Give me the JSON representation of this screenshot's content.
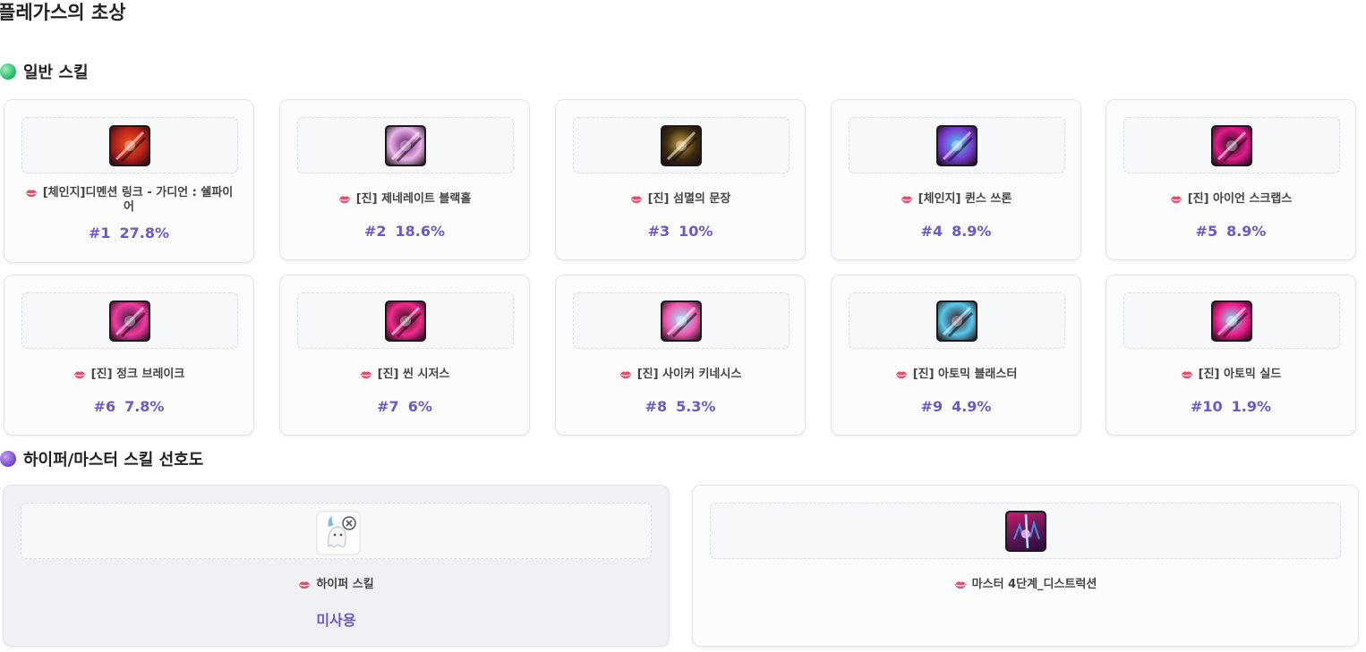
{
  "page_title": "플레가스의 초상",
  "sections": {
    "normal": "일반 스킬",
    "hyper_master": "하이퍼/마스터 스킬 선호도"
  },
  "skills": [
    {
      "name": "[체인지]디멘션 링크 - 가디언 : 쉘파이어",
      "rank": "#1",
      "pct": "27.8%",
      "icon": "dimension-link-icon",
      "colors": [
        "#b3201a",
        "#f05a1a"
      ]
    },
    {
      "name": "[진] 제네레이트 블랙홀",
      "rank": "#2",
      "pct": "18.6%",
      "icon": "black-hole-icon",
      "colors": [
        "#e8b5e8",
        "#6a1a6a"
      ]
    },
    {
      "name": "[진] 섬멸의 문장",
      "rank": "#3",
      "pct": "10%",
      "icon": "annihilation-emblem-icon",
      "colors": [
        "#3a2a10",
        "#c9a040"
      ]
    },
    {
      "name": "[체인지] 퀸스 쓰론",
      "rank": "#4",
      "pct": "8.9%",
      "icon": "queens-throne-icon",
      "colors": [
        "#7a3ad0",
        "#4ac8f0"
      ]
    },
    {
      "name": "[진] 아이언 스크랩스",
      "rank": "#5",
      "pct": "8.9%",
      "icon": "iron-scraps-icon",
      "colors": [
        "#e01a8a",
        "#2a0a1a"
      ]
    },
    {
      "name": "[진] 정크 브레이크",
      "rank": "#6",
      "pct": "7.8%",
      "icon": "junk-break-icon",
      "colors": [
        "#f03aa0",
        "#3a1a3a"
      ]
    },
    {
      "name": "[진] 씬 시저스",
      "rank": "#7",
      "pct": "6%",
      "icon": "thin-scissors-icon",
      "colors": [
        "#f02a8a",
        "#3a0a20"
      ]
    },
    {
      "name": "[진] 사이커 키네시스",
      "rank": "#8",
      "pct": "5.3%",
      "icon": "psyker-kinesis-icon",
      "colors": [
        "#f05ab0",
        "#9ae0f8"
      ]
    },
    {
      "name": "[진] 아토믹 블래스터",
      "rank": "#9",
      "pct": "4.9%",
      "icon": "atomic-blaster-icon",
      "colors": [
        "#5ac8e8",
        "#3a1a2a"
      ]
    },
    {
      "name": "[진] 아토믹 실드",
      "rank": "#10",
      "pct": "1.9%",
      "icon": "atomic-shield-icon",
      "colors": [
        "#f01a8a",
        "#80e0f0"
      ]
    }
  ],
  "hyper": {
    "name": "하이퍼 스킬",
    "status": "미사용",
    "icon": "no-image-placeholder-icon"
  },
  "master": {
    "name": "마스터 4단계_디스트럭션",
    "icon": "destruction-icon",
    "colors": [
      "#d01a6a",
      "#2a0a3a"
    ]
  },
  "colors": {
    "accent": "#6b58c9",
    "lip": "#e0506a"
  }
}
